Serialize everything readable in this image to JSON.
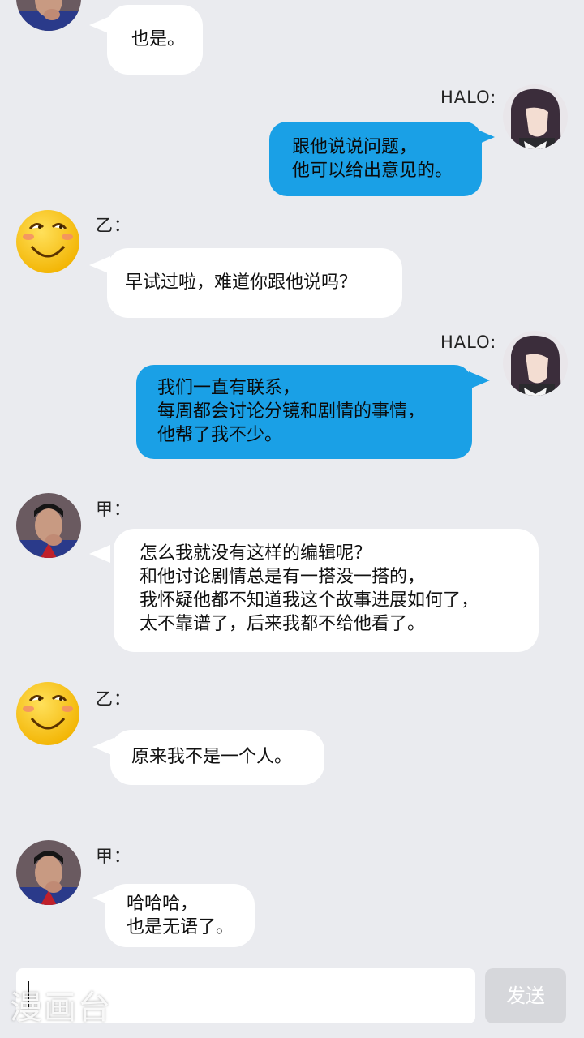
{
  "messages": [
    {
      "sender": "",
      "lines": [
        "也是。"
      ]
    },
    {
      "sender": "HALO:",
      "lines": [
        "跟他说说问题，",
        "他可以给出意见的。"
      ]
    },
    {
      "sender": "乙：",
      "lines": [
        "早试过啦，难道你跟他说吗？"
      ]
    },
    {
      "sender": "HALO:",
      "lines": [
        "我们一直有联系，",
        "每周都会讨论分镜和剧情的事情，",
        "他帮了我不少。"
      ]
    },
    {
      "sender": "甲：",
      "lines": [
        "怎么我就没有这样的编辑呢？",
        "和他讨论剧情总是有一搭没一搭的，",
        "我怀疑他都不知道我这个故事进展如何了，",
        "太不靠谱了，后来我都不给他看了。"
      ]
    },
    {
      "sender": "乙：",
      "lines": [
        "原来我不是一个人。"
      ]
    },
    {
      "sender": "甲：",
      "lines": [
        "哈哈哈，",
        "也是无语了。"
      ]
    }
  ],
  "composer": {
    "send_label": "发送",
    "input_value": ""
  },
  "watermark": "漫画台",
  "colors": {
    "background": "#eaebef",
    "outgoing_bubble": "#1aa0e6",
    "incoming_bubble": "#ffffff"
  },
  "avatars": {
    "jia": "man-photo-avatar",
    "yi": "smiley-emoji-avatar",
    "halo": "anime-man-avatar"
  }
}
